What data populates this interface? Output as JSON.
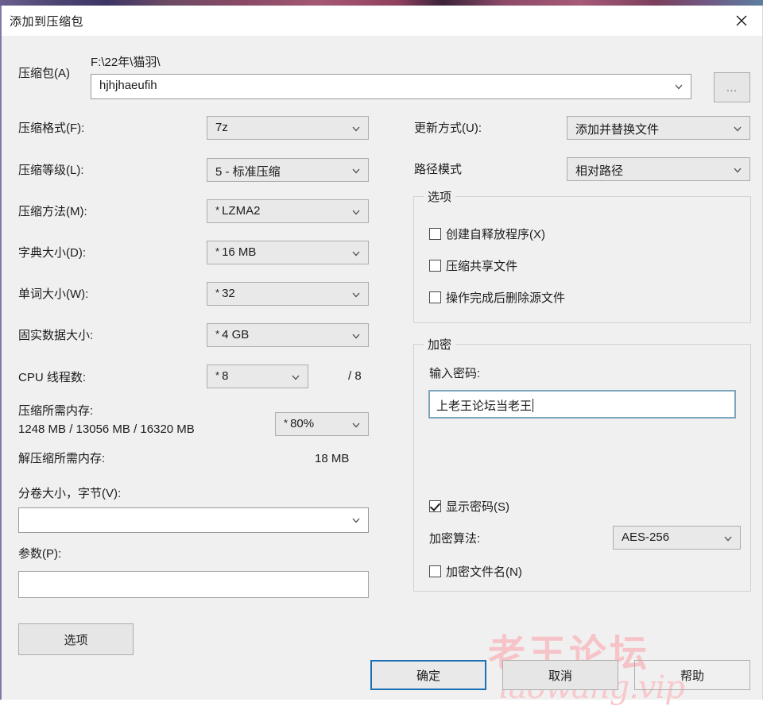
{
  "window": {
    "title": "添加到压缩包",
    "close_icon": "close-icon"
  },
  "archive": {
    "label": "压缩包(A)",
    "path": "F:\\22年\\猫羽\\",
    "name": "hjhjhaeufih",
    "browse_label": "..."
  },
  "left_fields": {
    "format": {
      "label": "压缩格式(F):",
      "value": "7z"
    },
    "level": {
      "label": "压缩等级(L):",
      "value": "5 - 标准压缩"
    },
    "method": {
      "label": "压缩方法(M):",
      "value": "LZMA2",
      "star": "*"
    },
    "dictionary": {
      "label": "字典大小(D):",
      "value": "16 MB",
      "star": "*"
    },
    "word_size": {
      "label": "单词大小(W):",
      "value": "32",
      "star": "*"
    },
    "solid_block": {
      "label": "固实数据大小:",
      "value": "4 GB",
      "star": "*"
    },
    "cpu_threads": {
      "label": "CPU 线程数:",
      "value": "8",
      "star": "*",
      "total": "/ 8"
    },
    "mem_compress": {
      "label": "压缩所需内存:",
      "detail": "1248 MB / 13056 MB / 16320 MB",
      "percent": "80%",
      "star": "*"
    },
    "mem_decompress": {
      "label": "解压缩所需内存:",
      "value": "18 MB"
    },
    "volume_size": {
      "label": "分卷大小，字节(V):",
      "value": ""
    },
    "parameters": {
      "label": "参数(P):",
      "value": ""
    },
    "options_button": "选项"
  },
  "right_fields": {
    "update_mode": {
      "label": "更新方式(U):",
      "value": "添加并替换文件"
    },
    "path_mode": {
      "label": "路径模式",
      "value": "相对路径"
    },
    "options_group": {
      "title": "选项",
      "items": [
        {
          "label": "创建自释放程序(X)",
          "checked": false
        },
        {
          "label": "压缩共享文件",
          "checked": false
        },
        {
          "label": "操作完成后删除源文件",
          "checked": false
        }
      ]
    },
    "encryption_group": {
      "title": "加密",
      "password_label": "输入密码:",
      "password_value": "上老王论坛当老王",
      "show_password": {
        "label": "显示密码(S)",
        "checked": true
      },
      "algorithm_label": "加密算法:",
      "algorithm_value": "AES-256",
      "encrypt_names": {
        "label": "加密文件名(N)",
        "checked": false
      }
    }
  },
  "footer": {
    "ok": "确定",
    "cancel": "取消",
    "help": "帮助"
  },
  "watermark": {
    "main": "老王论坛",
    "sub": "laowang.vip",
    "color": "#f6c3c8"
  }
}
